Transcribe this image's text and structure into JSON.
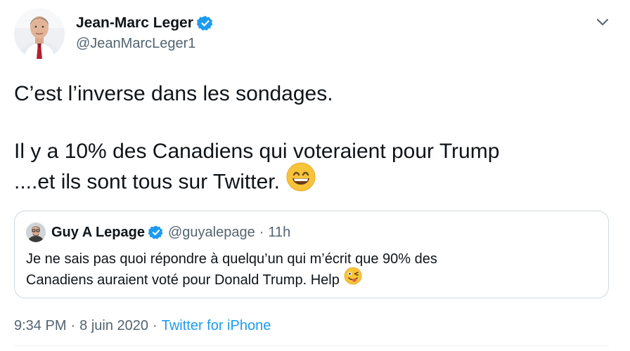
{
  "tweet": {
    "author": {
      "display_name": "Jean-Marc Leger",
      "handle": "@JeanMarcLeger1",
      "verified": true,
      "verified_icon": "verified-badge-icon"
    },
    "menu_icon": "chevron-down-icon",
    "text_lines": [
      "C’est l’inverse dans les sondages.",
      "",
      "Il y a 10% des Canadiens qui voteraient pour Trump",
      "....et ils sont tous sur Twitter."
    ],
    "emoji": "grinning-face-with-smiling-eyes-icon",
    "quote": {
      "display_name": "Guy A Lepage",
      "verified": true,
      "handle": "@guyalepage",
      "dot": "·",
      "time": "11h",
      "text_lines": [
        "Je ne sais pas quoi répondre à quelqu’un qui m’écrit que 90% des",
        "Canadiens auraient voté pour Donald Trump. Help"
      ],
      "emoji": "winking-face-with-tongue-icon"
    },
    "meta": {
      "time": "9:34 PM",
      "dot1": "·",
      "date": "8 juin 2020",
      "dot2": "·",
      "source": "Twitter for iPhone"
    }
  },
  "colors": {
    "text_primary": "#0f1419",
    "text_secondary": "#536471",
    "link": "#1d9bf0",
    "border": "#cfd9de",
    "verified": "#1d9bf0"
  }
}
